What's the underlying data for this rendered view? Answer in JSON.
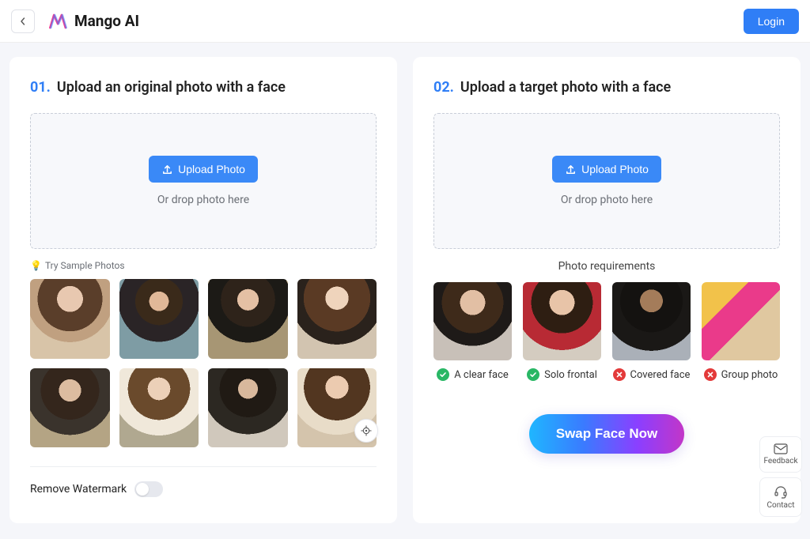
{
  "header": {
    "brand": "Mango AI",
    "login_label": "Login"
  },
  "left": {
    "step_num": "01.",
    "step_title": "Upload an original photo with a face",
    "upload_label": "Upload Photo",
    "drop_hint": "Or drop photo here",
    "sample_label": "Try Sample Photos",
    "watermark_label": "Remove Watermark"
  },
  "right": {
    "step_num": "02.",
    "step_title": "Upload a target photo with a face",
    "upload_label": "Upload Photo",
    "drop_hint": "Or drop photo here",
    "requirements_title": "Photo requirements",
    "requirements": [
      {
        "label": "A clear face",
        "ok": true
      },
      {
        "label": "Solo frontal",
        "ok": true
      },
      {
        "label": "Covered face",
        "ok": false
      },
      {
        "label": "Group photo",
        "ok": false
      }
    ],
    "swap_label": "Swap Face Now"
  },
  "floats": {
    "feedback": "Feedback",
    "contact": "Contact"
  }
}
